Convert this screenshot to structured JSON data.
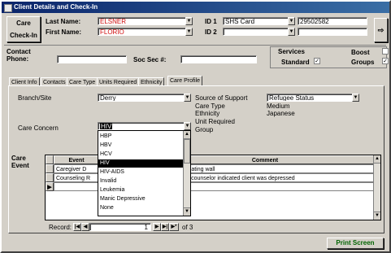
{
  "window": {
    "title": "Client Details and Check-In"
  },
  "header": {
    "check_in_button": "Care Check-In",
    "last_name_label": "Last Name:",
    "last_name_value": "ELSNER",
    "first_name_label": "First Name:",
    "first_name_value": "FLORIO",
    "id1_label": "ID 1",
    "id1_value": "SHS Card",
    "id1_number": "29502582",
    "id2_label": "ID 2",
    "id2_value": "",
    "contact_phone_label": "Contact Phone:",
    "soc_sec_label": "Soc Sec #:",
    "services_label": "Services",
    "standard_label": "Standard",
    "standard_checked": "✓",
    "boost_label": "Boost",
    "groups_label": "Groups",
    "groups_checked": "✓"
  },
  "tabs": [
    {
      "label": "Client Info"
    },
    {
      "label": "Contacts"
    },
    {
      "label": "Care Type"
    },
    {
      "label": "Units Required"
    },
    {
      "label": "Ethnicity"
    },
    {
      "label": "Care Profile"
    }
  ],
  "profile": {
    "branch_label": "Branch/Site",
    "branch_value": "Derry",
    "care_concern_label": "Care Concern",
    "care_concern_value": "HIV",
    "source_support_label": "Source of Support",
    "source_support_value": "Refugee Status",
    "care_type_label": "Care Type",
    "care_type_value": "Medium",
    "ethnicity_label": "Ethnicity",
    "ethnicity_value": "Japanese",
    "unit_required_label": "Unit Required",
    "group_label": "Group"
  },
  "care_concern_options": [
    {
      "label": "HBP"
    },
    {
      "label": "HBV"
    },
    {
      "label": "HCV"
    },
    {
      "label": "HIV",
      "selected": true
    },
    {
      "label": "HIV-AIDS"
    },
    {
      "label": "Invalid"
    },
    {
      "label": "Leukemia"
    },
    {
      "label": "Manic Depressive"
    },
    {
      "label": "None"
    }
  ],
  "care_event": {
    "section_label": "Care Event",
    "columns": [
      "Event",
      "Comment"
    ],
    "rows": [
      {
        "event": "Caregiver D",
        "comment": "Visits non-beating wall"
      },
      {
        "event": "Counseling R",
        "comment": "Assessment counselor indicated client was depressed"
      }
    ]
  },
  "navigator": {
    "record_label": "Record:",
    "current": "1",
    "of_label": "of 3"
  },
  "print_button": "Print Screen"
}
